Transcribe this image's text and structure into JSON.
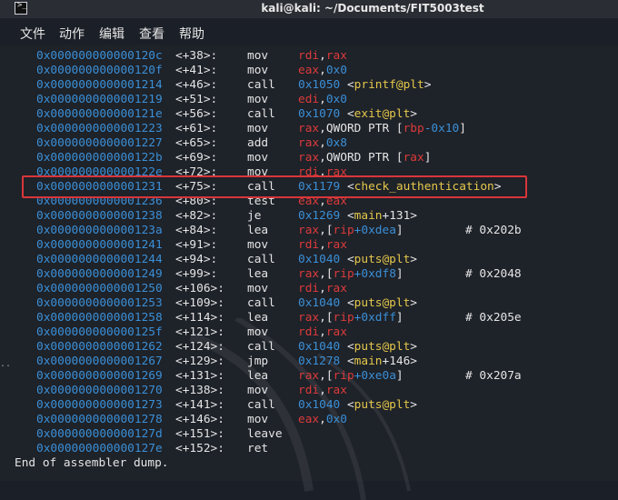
{
  "window": {
    "title": "kali@kali: ~/Documents/FIT5003test"
  },
  "menu": [
    "文件",
    "动作",
    "编辑",
    "查看",
    "帮助"
  ],
  "rows": [
    {
      "addr": "0x000000000000120c",
      "off": "<+38>:",
      "mn": "mov",
      "ops": [
        [
          "rdi",
          "reg"
        ],
        [
          ",",
          "txt"
        ],
        [
          "rax",
          "reg"
        ]
      ],
      "cmt": ""
    },
    {
      "addr": "0x000000000000120f",
      "off": "<+41>:",
      "mn": "mov",
      "ops": [
        [
          "eax",
          "reg"
        ],
        [
          ",",
          "txt"
        ],
        [
          "0x0",
          "num"
        ]
      ],
      "cmt": ""
    },
    {
      "addr": "0x0000000000001214",
      "off": "<+46>:",
      "mn": "call",
      "ops": [
        [
          "0x1050",
          "num"
        ],
        [
          " <",
          "txt"
        ],
        [
          "printf@plt",
          "fn"
        ],
        [
          ">",
          "txt"
        ]
      ],
      "cmt": ""
    },
    {
      "addr": "0x0000000000001219",
      "off": "<+51>:",
      "mn": "mov",
      "ops": [
        [
          "edi",
          "reg"
        ],
        [
          ",",
          "txt"
        ],
        [
          "0x0",
          "num"
        ]
      ],
      "cmt": ""
    },
    {
      "addr": "0x000000000000121e",
      "off": "<+56>:",
      "mn": "call",
      "ops": [
        [
          "0x1070",
          "num"
        ],
        [
          " <",
          "txt"
        ],
        [
          "exit@plt",
          "fn"
        ],
        [
          ">",
          "txt"
        ]
      ],
      "cmt": ""
    },
    {
      "addr": "0x0000000000001223",
      "off": "<+61>:",
      "mn": "mov",
      "ops": [
        [
          "rax",
          "reg"
        ],
        [
          ",QWORD PTR [",
          "txt"
        ],
        [
          "rbp",
          "reg"
        ],
        [
          "-0x10",
          "num"
        ],
        [
          "]",
          "txt"
        ]
      ],
      "cmt": ""
    },
    {
      "addr": "0x0000000000001227",
      "off": "<+65>:",
      "mn": "add",
      "ops": [
        [
          "rax",
          "reg"
        ],
        [
          ",",
          "txt"
        ],
        [
          "0x8",
          "num"
        ]
      ],
      "cmt": ""
    },
    {
      "addr": "0x000000000000122b",
      "off": "<+69>:",
      "mn": "mov",
      "ops": [
        [
          "rax",
          "reg"
        ],
        [
          ",QWORD PTR [",
          "txt"
        ],
        [
          "rax",
          "reg"
        ],
        [
          "]",
          "txt"
        ]
      ],
      "cmt": ""
    },
    {
      "addr": "0x000000000000122e",
      "off": "<+72>:",
      "mn": "mov",
      "ops": [
        [
          "rdi",
          "reg"
        ],
        [
          ",",
          "txt"
        ],
        [
          "rax",
          "reg"
        ]
      ],
      "cmt": ""
    },
    {
      "addr": "0x0000000000001231",
      "off": "<+75>:",
      "mn": "call",
      "ops": [
        [
          "0x1179",
          "num"
        ],
        [
          " <",
          "txt"
        ],
        [
          "check_authentication",
          "fn"
        ],
        [
          ">",
          "txt"
        ]
      ],
      "cmt": ""
    },
    {
      "addr": "0x0000000000001236",
      "off": "<+80>:",
      "mn": "test",
      "ops": [
        [
          "eax",
          "reg"
        ],
        [
          ",",
          "txt"
        ],
        [
          "eax",
          "reg"
        ]
      ],
      "cmt": ""
    },
    {
      "addr": "0x0000000000001238",
      "off": "<+82>:",
      "mn": "je",
      "ops": [
        [
          "0x1269",
          "num"
        ],
        [
          " <",
          "txt"
        ],
        [
          "main",
          "fn"
        ],
        [
          "+131>",
          "txt"
        ]
      ],
      "cmt": ""
    },
    {
      "addr": "0x000000000000123a",
      "off": "<+84>:",
      "mn": "lea",
      "ops": [
        [
          "rax",
          "reg"
        ],
        [
          ",[",
          "txt"
        ],
        [
          "rip",
          "reg"
        ],
        [
          "+0xdea",
          "num"
        ],
        [
          "]",
          "txt"
        ]
      ],
      "cmt": "# 0x202b"
    },
    {
      "addr": "0x0000000000001241",
      "off": "<+91>:",
      "mn": "mov",
      "ops": [
        [
          "rdi",
          "reg"
        ],
        [
          ",",
          "txt"
        ],
        [
          "rax",
          "reg"
        ]
      ],
      "cmt": ""
    },
    {
      "addr": "0x0000000000001244",
      "off": "<+94>:",
      "mn": "call",
      "ops": [
        [
          "0x1040",
          "num"
        ],
        [
          " <",
          "txt"
        ],
        [
          "puts@plt",
          "fn"
        ],
        [
          ">",
          "txt"
        ]
      ],
      "cmt": ""
    },
    {
      "addr": "0x0000000000001249",
      "off": "<+99>:",
      "mn": "lea",
      "ops": [
        [
          "rax",
          "reg"
        ],
        [
          ",[",
          "txt"
        ],
        [
          "rip",
          "reg"
        ],
        [
          "+0xdf8",
          "num"
        ],
        [
          "]",
          "txt"
        ]
      ],
      "cmt": "# 0x2048"
    },
    {
      "addr": "0x0000000000001250",
      "off": "<+106>:",
      "mn": "mov",
      "ops": [
        [
          "rdi",
          "reg"
        ],
        [
          ",",
          "txt"
        ],
        [
          "rax",
          "reg"
        ]
      ],
      "cmt": ""
    },
    {
      "addr": "0x0000000000001253",
      "off": "<+109>:",
      "mn": "call",
      "ops": [
        [
          "0x1040",
          "num"
        ],
        [
          " <",
          "txt"
        ],
        [
          "puts@plt",
          "fn"
        ],
        [
          ">",
          "txt"
        ]
      ],
      "cmt": ""
    },
    {
      "addr": "0x0000000000001258",
      "off": "<+114>:",
      "mn": "lea",
      "ops": [
        [
          "rax",
          "reg"
        ],
        [
          ",[",
          "txt"
        ],
        [
          "rip",
          "reg"
        ],
        [
          "+0xdff",
          "num"
        ],
        [
          "]",
          "txt"
        ]
      ],
      "cmt": "# 0x205e"
    },
    {
      "addr": "0x000000000000125f",
      "off": "<+121>:",
      "mn": "mov",
      "ops": [
        [
          "rdi",
          "reg"
        ],
        [
          ",",
          "txt"
        ],
        [
          "rax",
          "reg"
        ]
      ],
      "cmt": ""
    },
    {
      "addr": "0x0000000000001262",
      "off": "<+124>:",
      "mn": "call",
      "ops": [
        [
          "0x1040",
          "num"
        ],
        [
          " <",
          "txt"
        ],
        [
          "puts@plt",
          "fn"
        ],
        [
          ">",
          "txt"
        ]
      ],
      "cmt": ""
    },
    {
      "addr": "0x0000000000001267",
      "off": "<+129>:",
      "mn": "jmp",
      "ops": [
        [
          "0x1278",
          "num"
        ],
        [
          " <",
          "txt"
        ],
        [
          "main",
          "fn"
        ],
        [
          "+146>",
          "txt"
        ]
      ],
      "cmt": ""
    },
    {
      "addr": "0x0000000000001269",
      "off": "<+131>:",
      "mn": "lea",
      "ops": [
        [
          "rax",
          "reg"
        ],
        [
          ",[",
          "txt"
        ],
        [
          "rip",
          "reg"
        ],
        [
          "+0xe0a",
          "num"
        ],
        [
          "]",
          "txt"
        ]
      ],
      "cmt": "# 0x207a"
    },
    {
      "addr": "0x0000000000001270",
      "off": "<+138>:",
      "mn": "mov",
      "ops": [
        [
          "rdi",
          "reg"
        ],
        [
          ",",
          "txt"
        ],
        [
          "rax",
          "reg"
        ]
      ],
      "cmt": ""
    },
    {
      "addr": "0x0000000000001273",
      "off": "<+141>:",
      "mn": "call",
      "ops": [
        [
          "0x1040",
          "num"
        ],
        [
          " <",
          "txt"
        ],
        [
          "puts@plt",
          "fn"
        ],
        [
          ">",
          "txt"
        ]
      ],
      "cmt": ""
    },
    {
      "addr": "0x0000000000001278",
      "off": "<+146>:",
      "mn": "mov",
      "ops": [
        [
          "eax",
          "reg"
        ],
        [
          ",",
          "txt"
        ],
        [
          "0x0",
          "num"
        ]
      ],
      "cmt": ""
    },
    {
      "addr": "0x000000000000127d",
      "off": "<+151>:",
      "mn": "leave",
      "ops": [],
      "cmt": ""
    },
    {
      "addr": "0x000000000000127e",
      "off": "<+152>:",
      "mn": "ret",
      "ops": [],
      "cmt": ""
    }
  ],
  "end_text": "End of assembler dump.",
  "colors": {
    "address": "#3b8fd6",
    "register": "#dc3b3b",
    "symbol": "#e5c84b",
    "highlight_box": "#d8363a"
  }
}
